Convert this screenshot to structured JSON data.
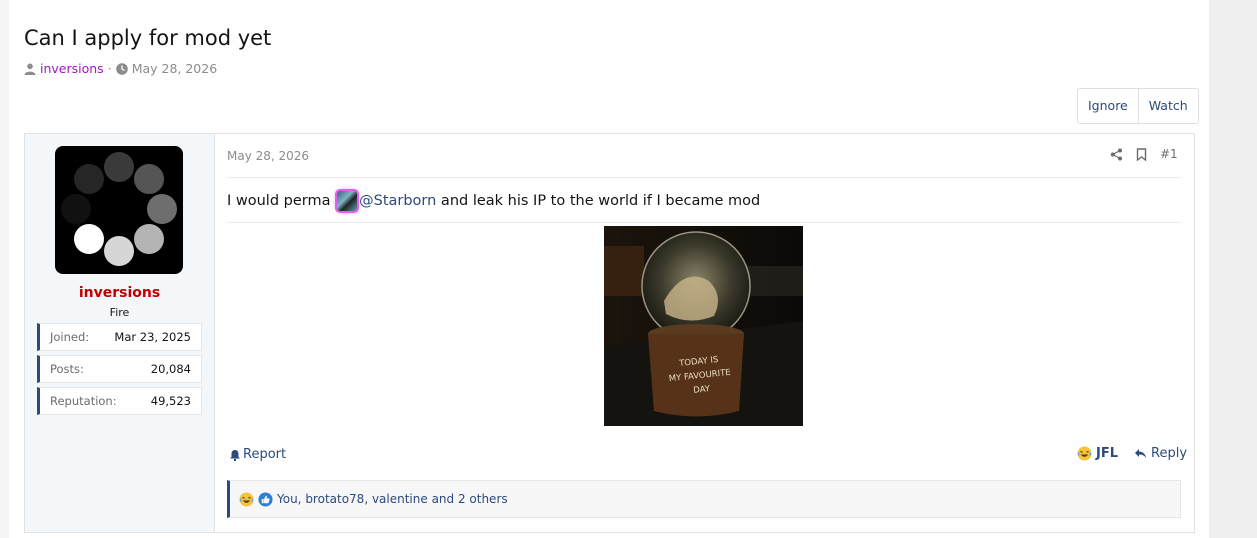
{
  "thread": {
    "title": "Can I apply for mod yet",
    "author": "inversions",
    "separator": "·",
    "date": "May 28, 2026"
  },
  "thread_buttons": {
    "ignore": "Ignore",
    "watch": "Watch"
  },
  "user": {
    "name": "inversions",
    "title": "Fire",
    "name_color": "#c30000",
    "stats": [
      {
        "label": "Joined:",
        "value": "Mar 23, 2025"
      },
      {
        "label": "Posts:",
        "value": "20,084"
      },
      {
        "label": "Reputation:",
        "value": "49,523"
      }
    ]
  },
  "post": {
    "date": "May 28, 2026",
    "number": "#1",
    "text_before": "I would perma ",
    "mention": "@Starborn",
    "text_after": " and leak his IP to the world if I became mod",
    "image_caption": "TODAY IS MY FAVOURITE DAY"
  },
  "footer": {
    "report": "Report",
    "reaction_label": "JFL",
    "reply": "Reply"
  },
  "reactions": {
    "text": "You, brotato78, valentine and 2 others",
    "icons": [
      "laughing-face-icon",
      "like-icon"
    ]
  },
  "colors": {
    "link": "#2b4a7d",
    "author": "#a316c4",
    "accent": "#2b4a7d"
  }
}
